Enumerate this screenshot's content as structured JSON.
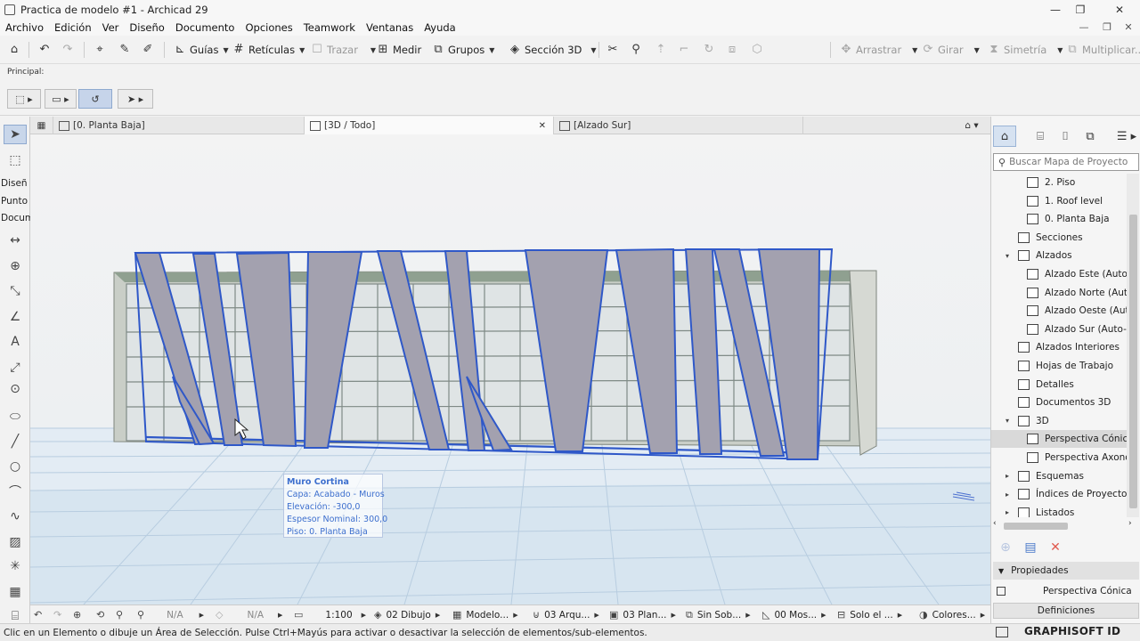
{
  "window": {
    "title": "Practica de modelo #1 - Archicad 29",
    "minimize": "—",
    "restore": "❐",
    "close": "✕"
  },
  "menu": [
    "Archivo",
    "Edición",
    "Ver",
    "Diseño",
    "Documento",
    "Opciones",
    "Teamwork",
    "Ventanas",
    "Ayuda"
  ],
  "mdi_controls": {
    "minimize": "—",
    "restore": "❐",
    "close": "✕"
  },
  "toolbar": {
    "guias": "Guías",
    "reticulas": "Retículas",
    "trazar": "Trazar",
    "medir": "Medir",
    "grupos": "Grupos",
    "seccion3d": "Sección 3D",
    "arrastrar": "Arrastrar",
    "girar": "Girar",
    "simetria": "Simetría",
    "multiplicar": "Multiplicar..."
  },
  "infobox": {
    "label": "Principal:"
  },
  "toolbox": {
    "diseno": "Diseñ",
    "punto": "Punto",
    "docum": "Docum"
  },
  "tabs": [
    {
      "label": "[0. Planta Baja]"
    },
    {
      "label": "[3D / Todo]"
    },
    {
      "label": "[Alzado Sur]"
    }
  ],
  "tab_close": "✕",
  "tooltip": {
    "title": "Muro Cortina",
    "capa": "Capa: Acabado - Muros",
    "elevacion": "Elevación: -300,0",
    "espesor": "Espesor Nominal: 300,0",
    "piso": "Piso: 0. Planta Baja"
  },
  "navigator": {
    "search_placeholder": "Buscar Mapa de Proyecto",
    "tree": [
      {
        "label": "2. Piso",
        "level": 2,
        "expander": ""
      },
      {
        "label": "1. Roof level",
        "level": 2,
        "expander": ""
      },
      {
        "label": "0. Planta Baja",
        "level": 2,
        "expander": ""
      },
      {
        "label": "Secciones",
        "level": 1,
        "expander": ""
      },
      {
        "label": "Alzados",
        "level": 1,
        "expander": "open"
      },
      {
        "label": "Alzado Este (Auto-R",
        "level": 2,
        "expander": ""
      },
      {
        "label": "Alzado Norte (Auto",
        "level": 2,
        "expander": ""
      },
      {
        "label": "Alzado Oeste (Auto",
        "level": 2,
        "expander": ""
      },
      {
        "label": "Alzado Sur (Auto-R",
        "level": 2,
        "expander": ""
      },
      {
        "label": "Alzados Interiores",
        "level": 1,
        "expander": ""
      },
      {
        "label": "Hojas de Trabajo",
        "level": 1,
        "expander": ""
      },
      {
        "label": "Detalles",
        "level": 1,
        "expander": ""
      },
      {
        "label": "Documentos 3D",
        "level": 1,
        "expander": ""
      },
      {
        "label": "3D",
        "level": 1,
        "expander": "open"
      },
      {
        "label": "Perspectiva Cónica",
        "level": 2,
        "expander": "",
        "selected": true
      },
      {
        "label": "Perspectiva Axonom",
        "level": 2,
        "expander": ""
      },
      {
        "label": "Esquemas",
        "level": 1,
        "expander": "closed"
      },
      {
        "label": "Índices de Proyecto",
        "level": 1,
        "expander": "closed"
      },
      {
        "label": "Listados",
        "level": 1,
        "expander": "closed"
      }
    ],
    "properties_header": "Propiedades",
    "properties_value": "Perspectiva Cónica",
    "definitions_button": "Definiciones"
  },
  "quickbar": {
    "na1": "N/A",
    "na2": "N/A",
    "scale": "1:100",
    "layer_combo": "02 Dibujo",
    "model_view": "Modelo...",
    "pen_set": "03 Arqu...",
    "dimension": "03 Plan...",
    "override": "Sin Sob...",
    "renovation": "00 Mos...",
    "structure": "Solo el ...",
    "colors": "Colores..."
  },
  "status": {
    "message": "Clic en un Elemento o dibuje un Área de Selección. Pulse Ctrl+Mayús para activar o desactivar la selección de elementos/sub-elementos.",
    "brand": "GRAPHISOFT ID"
  }
}
